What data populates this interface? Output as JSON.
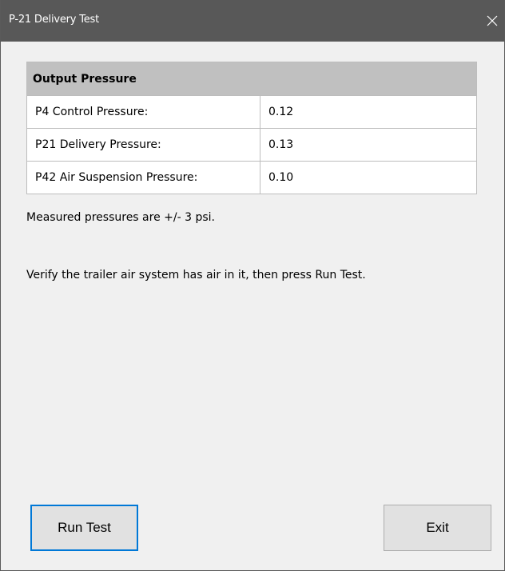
{
  "window": {
    "title": "P-21 Delivery Test",
    "close_icon": "close-icon"
  },
  "pressure_table": {
    "header": "Output Pressure",
    "rows": [
      {
        "label": "P4 Control Pressure:",
        "value": "0.12"
      },
      {
        "label": "P21 Delivery Pressure:",
        "value": "0.13"
      },
      {
        "label": "P42 Air Suspension Pressure:",
        "value": "0.10"
      }
    ]
  },
  "messages": {
    "accuracy_note": "Measured pressures are +/- 3 psi.",
    "instruction": "Verify the trailer air system has air in it, then press Run Test."
  },
  "buttons": {
    "run_test": "Run Test",
    "exit": "Exit"
  },
  "colors": {
    "titlebar": "#585858",
    "table_header": "#c0c0c0",
    "focus_border": "#0078d7",
    "button_face": "#e1e1e1"
  }
}
